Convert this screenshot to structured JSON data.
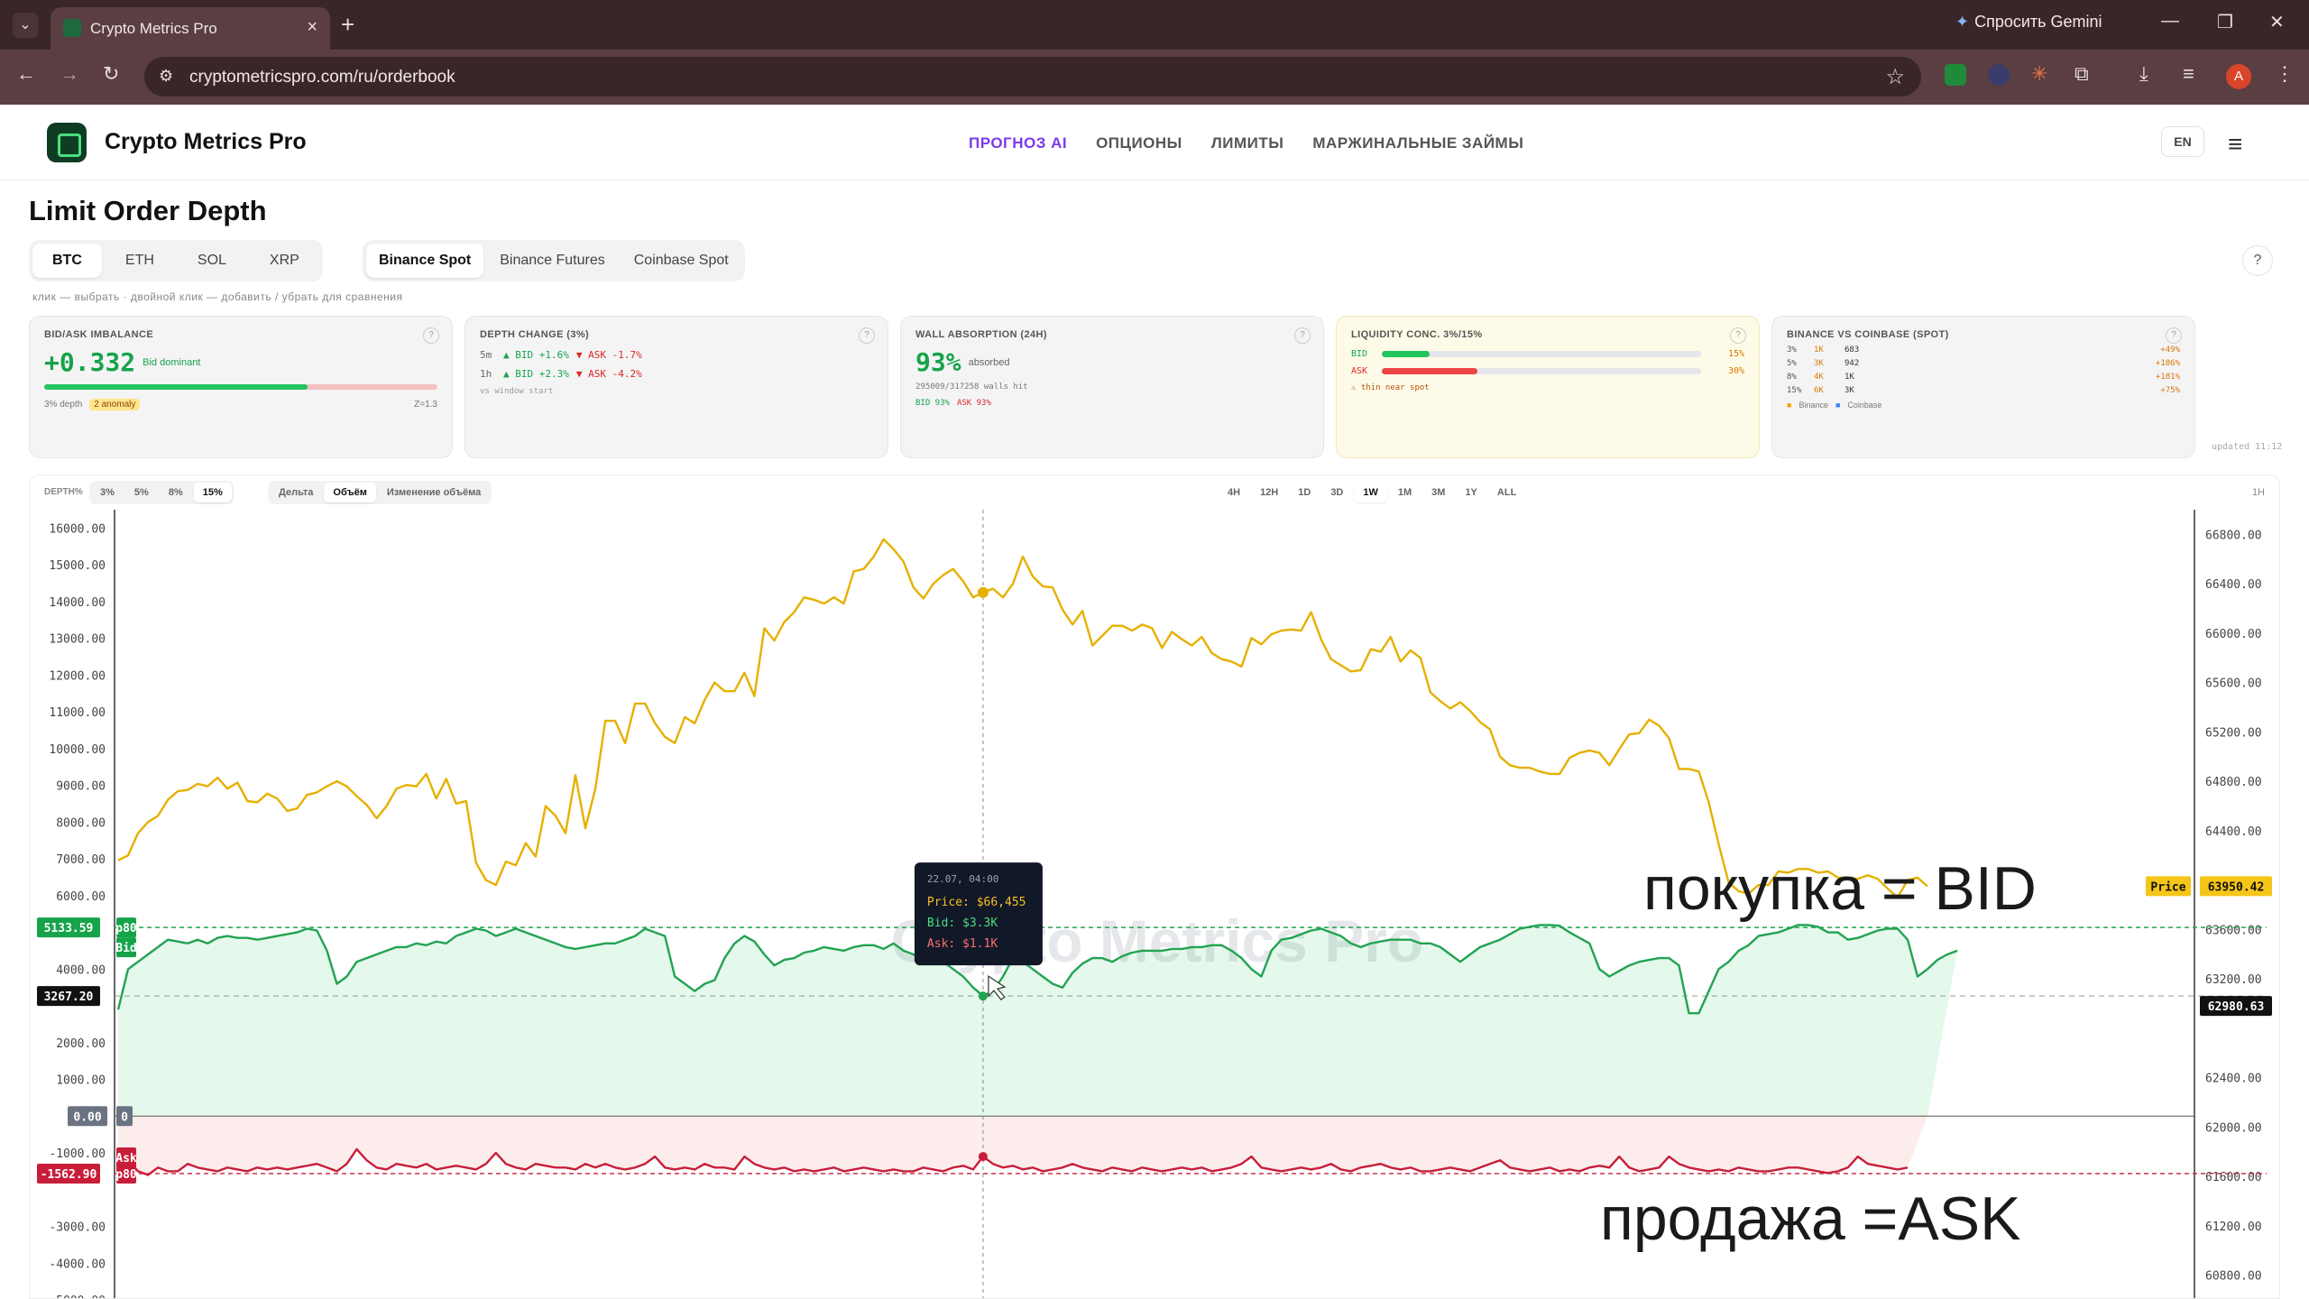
{
  "browser": {
    "tab_title": "Crypto Metrics Pro",
    "url": "cryptometricspro.com/ru/orderbook",
    "gemini_label": "Спросить Gemini",
    "avatar_letter": "A"
  },
  "site": {
    "brand": "Crypto Metrics Pro",
    "nav": [
      "ПРОГНОЗ AI",
      "ОПЦИОНЫ",
      "ЛИМИТЫ",
      "МАРЖИНАЛЬНЫЕ ЗАЙМЫ"
    ],
    "lang": "EN"
  },
  "page": {
    "title": "Limit Order Depth",
    "assets": [
      "BTC",
      "ETH",
      "SOL",
      "XRP"
    ],
    "selected_asset": "BTC",
    "exchanges": [
      "Binance Spot",
      "Binance Futures",
      "Coinbase Spot"
    ],
    "selected_exchange": "Binance Spot",
    "hint": "клик — выбрать · двойной клик — добавить / убрать для сравнения",
    "help": "?"
  },
  "cards": {
    "imbalance": {
      "title": "BID/ASK IMBALANCE",
      "value": "+0.332",
      "note": "Bid dominant",
      "fill_fraction": 0.67,
      "foot_left": "3% depth",
      "anomaly": "2 anomaly",
      "foot_right": "Z=1.3"
    },
    "depth_change": {
      "title": "DEPTH CHANGE (3%)",
      "rows": [
        {
          "tf": "5m",
          "bid": "▲ BID +1.6%",
          "ask": "▼ ASK -1.7%"
        },
        {
          "tf": "1h",
          "bid": "▲ BID +2.3%",
          "ask": "▼ ASK -4.2%"
        }
      ],
      "foot": "vs window start"
    },
    "wall": {
      "title": "WALL ABSORPTION (24H)",
      "value": "93%",
      "note": "absorbed",
      "detail": "295009/317258 walls hit",
      "bid": "BID 93%",
      "ask": "ASK 93%"
    },
    "liquidity": {
      "title": "LIQUIDITY CONC. 3%/15%",
      "bid_label": "BID",
      "bid_value": "15%",
      "bid_fraction": 0.15,
      "ask_label": "ASK",
      "ask_value": "30%",
      "ask_fraction": 0.3,
      "warn": "⚠ thin near spot"
    },
    "binance_vs_coinbase": {
      "title": "BINANCE VS COINBASE (SPOT)",
      "rows": [
        {
          "d": "3%",
          "b": "1K",
          "c": "683",
          "diff": "+49%"
        },
        {
          "d": "5%",
          "b": "3K",
          "c": "942",
          "diff": "+186%"
        },
        {
          "d": "8%",
          "b": "4K",
          "c": "1K",
          "diff": "+181%"
        },
        {
          "d": "15%",
          "b": "6K",
          "c": "3K",
          "diff": "+75%"
        }
      ],
      "legend_b": "Binance",
      "legend_c": "Coinbase"
    },
    "updated": "updated 11:12"
  },
  "chart_toolbar": {
    "depth_label": "DEPTH%",
    "depths": [
      "3%",
      "5%",
      "8%",
      "15%"
    ],
    "selected_depth": "15%",
    "modes": [
      "Дельта",
      "Объём",
      "Изменение объёма"
    ],
    "selected_mode": "Объём",
    "ranges": [
      "4H",
      "12H",
      "1D",
      "3D",
      "1W",
      "1M",
      "3M",
      "1Y",
      "ALL"
    ],
    "selected_range": "1W",
    "interval": "1H"
  },
  "chart_data": {
    "type": "line",
    "watermark": "Crypto Metrics Pro",
    "left_ticks": [
      "16000.00",
      "15000.00",
      "14000.00",
      "13000.00",
      "12000.00",
      "11000.00",
      "10000.00",
      "9000.00",
      "8000.00",
      "7000.00",
      "6000.00",
      "5133.59",
      "4000.00",
      "3267.20",
      "2000.00",
      "1000.00",
      "0.00",
      "-1000.00",
      "-1562.90",
      "-3000.00",
      "-4000.00",
      "-5000.00"
    ],
    "right_ticks": [
      "66800.00",
      "66400.00",
      "66000.00",
      "65600.00",
      "65200.00",
      "64800.00",
      "64400.00",
      "63950.42",
      "63600.00",
      "63200.00",
      "62980.63",
      "62400.00",
      "62000.00",
      "61600.00",
      "61200.00",
      "60800.00"
    ],
    "left_range": [
      -5000,
      16500
    ],
    "right_range": [
      60600,
      67000
    ],
    "badges": {
      "bid_p80": "5133.59",
      "bid_current": "3267.20",
      "zero": "0.00",
      "ask_p80": "-1562.90",
      "price_current": "63950.42",
      "price_cursor": "62980.63",
      "p80": "p80",
      "bid": "Bid",
      "ask": "Ask",
      "price": "Price",
      "zero_tag": "0"
    },
    "series": [
      {
        "name": "Price",
        "color": "#e6b000",
        "axis": "right",
        "values": [
          64160,
          64200,
          64380,
          64470,
          64520,
          64650,
          64720,
          64730,
          64780,
          64760,
          64830,
          64740,
          64790,
          64640,
          64630,
          64700,
          64660,
          64560,
          64580,
          64690,
          64710,
          64760,
          64800,
          64760,
          64680,
          64610,
          64500,
          64600,
          64740,
          64770,
          64760,
          64860,
          64660,
          64820,
          64620,
          64640,
          64140,
          64000,
          63960,
          64150,
          64120,
          64300,
          64190,
          64600,
          64520,
          64380,
          64850,
          64420,
          64740,
          65290,
          65290,
          65110,
          65430,
          65430,
          65270,
          65160,
          65110,
          65320,
          65270,
          65460,
          65600,
          65530,
          65530,
          65680,
          65490,
          66040,
          65940,
          66090,
          66170,
          66290,
          66270,
          66240,
          66290,
          66240,
          66500,
          66520,
          66620,
          66760,
          66680,
          66580,
          66370,
          66280,
          66400,
          66470,
          66520,
          66420,
          66290,
          66330,
          66360,
          66290,
          66400,
          66620,
          66460,
          66380,
          66370,
          66190,
          66070,
          66180,
          65900,
          65980,
          66060,
          66060,
          66020,
          66070,
          66040,
          65880,
          66010,
          65950,
          65900,
          65970,
          65840,
          65790,
          65770,
          65730,
          65960,
          65910,
          65990,
          66020,
          66030,
          66020,
          66170,
          65950,
          65790,
          65740,
          65690,
          65700,
          65870,
          65850,
          65970,
          65770,
          65860,
          65800,
          65520,
          65450,
          65390,
          65440,
          65370,
          65280,
          65220,
          65000,
          64930,
          64910,
          64910,
          64880,
          64860,
          64860,
          64990,
          65030,
          65050,
          65030,
          64930,
          65060,
          65180,
          65190,
          65300,
          65250,
          65150,
          64900,
          64900,
          64880,
          64630,
          64290,
          63980,
          63910,
          63890,
          63960,
          63960,
          64070,
          64060,
          64090,
          64090,
          64060,
          64070,
          64020,
          64020,
          64010,
          64040,
          64010,
          63930,
          63860,
          64000,
          64020,
          63950
        ]
      },
      {
        "name": "Bid",
        "color": "#22a352",
        "axis": "left",
        "values": [
          2900,
          4000,
          4200,
          4400,
          4600,
          4800,
          4750,
          4700,
          4800,
          4700,
          4850,
          4900,
          4850,
          4850,
          4800,
          4850,
          4900,
          4950,
          5000,
          5100,
          5050,
          4500,
          3600,
          3800,
          4200,
          4300,
          4400,
          4500,
          4600,
          4600,
          4700,
          4650,
          4750,
          4700,
          4900,
          5000,
          5100,
          5050,
          4900,
          5000,
          5100,
          5000,
          4900,
          4800,
          4700,
          4600,
          4550,
          4600,
          4650,
          4700,
          4700,
          4800,
          4900,
          5100,
          5000,
          4900,
          3800,
          3600,
          3400,
          3600,
          3700,
          4300,
          4700,
          4900,
          4750,
          4400,
          4100,
          4250,
          4300,
          4450,
          4500,
          4600,
          4550,
          4500,
          4600,
          4650,
          4650,
          4550,
          4700,
          4500,
          4400,
          4300,
          4300,
          4200,
          4000,
          3800,
          3500,
          3267,
          3400,
          3800,
          4300,
          4200,
          4000,
          3800,
          3600,
          3500,
          3900,
          4150,
          4300,
          4300,
          4200,
          4350,
          4450,
          4500,
          4500,
          4500,
          4550,
          4550,
          4600,
          4600,
          4650,
          4650,
          4500,
          4300,
          4000,
          3800,
          4500,
          4800,
          4850,
          4950,
          5050,
          5100,
          5000,
          4900,
          4700,
          4600,
          4700,
          4750,
          4800,
          4800,
          4800,
          4700,
          4700,
          4600,
          4400,
          4200,
          4400,
          4600,
          4700,
          4800,
          4950,
          5100,
          5150,
          5200,
          5200,
          5180,
          5000,
          4850,
          4700,
          4000,
          3800,
          3950,
          4100,
          4200,
          4250,
          4300,
          4300,
          4100,
          2800,
          2800,
          3400,
          4000,
          4200,
          4500,
          4650,
          4900,
          4950,
          5000,
          5100,
          5200,
          5200,
          5150,
          5000,
          5000,
          4800,
          4850,
          4950,
          5050,
          5100,
          5100,
          4800,
          3800,
          4000,
          4250,
          4400,
          4500
        ]
      },
      {
        "name": "Ask",
        "color": "#c81e3a",
        "axis": "left",
        "values": [
          -1100,
          -1200,
          -1500,
          -1600,
          -1400,
          -1500,
          -1500,
          -1300,
          -1400,
          -1450,
          -1500,
          -1400,
          -1450,
          -1500,
          -1400,
          -1450,
          -1400,
          -1450,
          -1400,
          -1350,
          -1300,
          -1400,
          -1500,
          -1300,
          -900,
          -1200,
          -1400,
          -1450,
          -1300,
          -1350,
          -1400,
          -1300,
          -1450,
          -1400,
          -1350,
          -1400,
          -1450,
          -1300,
          -1000,
          -1300,
          -1400,
          -1450,
          -1300,
          -1350,
          -1400,
          -1400,
          -1450,
          -1300,
          -1400,
          -1300,
          -1400,
          -1450,
          -1400,
          -1300,
          -1100,
          -1400,
          -1450,
          -1400,
          -1450,
          -1300,
          -1400,
          -1400,
          -1450,
          -1100,
          -1300,
          -1400,
          -1450,
          -1400,
          -1500,
          -1450,
          -1500,
          -1450,
          -1400,
          -1500,
          -1450,
          -1400,
          -1450,
          -1500,
          -1450,
          -1500,
          -1500,
          -1400,
          -1450,
          -1500,
          -1400,
          -1350,
          -1450,
          -1100,
          -1300,
          -1400,
          -1350,
          -1450,
          -1400,
          -1500,
          -1450,
          -1400,
          -1300,
          -1400,
          -1450,
          -1500,
          -1400,
          -1450,
          -1500,
          -1400,
          -1450,
          -1500,
          -1450,
          -1400,
          -1450,
          -1400,
          -1500,
          -1450,
          -1400,
          -1300,
          -1100,
          -1400,
          -1450,
          -1500,
          -1450,
          -1400,
          -1450,
          -1400,
          -1300,
          -1450,
          -1500,
          -1400,
          -1350,
          -1300,
          -1400,
          -1450,
          -1400,
          -1500,
          -1500,
          -1450,
          -1400,
          -1450,
          -1500,
          -1400,
          -1300,
          -1200,
          -1400,
          -1450,
          -1500,
          -1450,
          -1400,
          -1500,
          -1450,
          -1500,
          -1400,
          -1350,
          -1400,
          -1100,
          -1400,
          -1500,
          -1450,
          -1400,
          -1100,
          -1300,
          -1400,
          -1450,
          -1500,
          -1450,
          -1500,
          -1400,
          -1450,
          -1500,
          -1500,
          -1450,
          -1400,
          -1400,
          -1450,
          -1500,
          -1550,
          -1500,
          -1400,
          -1100,
          -1300,
          -1350,
          -1400,
          -1450,
          -1400
        ]
      }
    ],
    "cursor_index": 87,
    "tooltip": {
      "date": "22.07, 04:00",
      "price": "Price: $66,455",
      "bid": "Bid: $3.3K",
      "ask": "Ask: $1.1K"
    }
  },
  "annotations": {
    "bid_note": "покупка = BID",
    "ask_note": "продажа =ASK"
  }
}
